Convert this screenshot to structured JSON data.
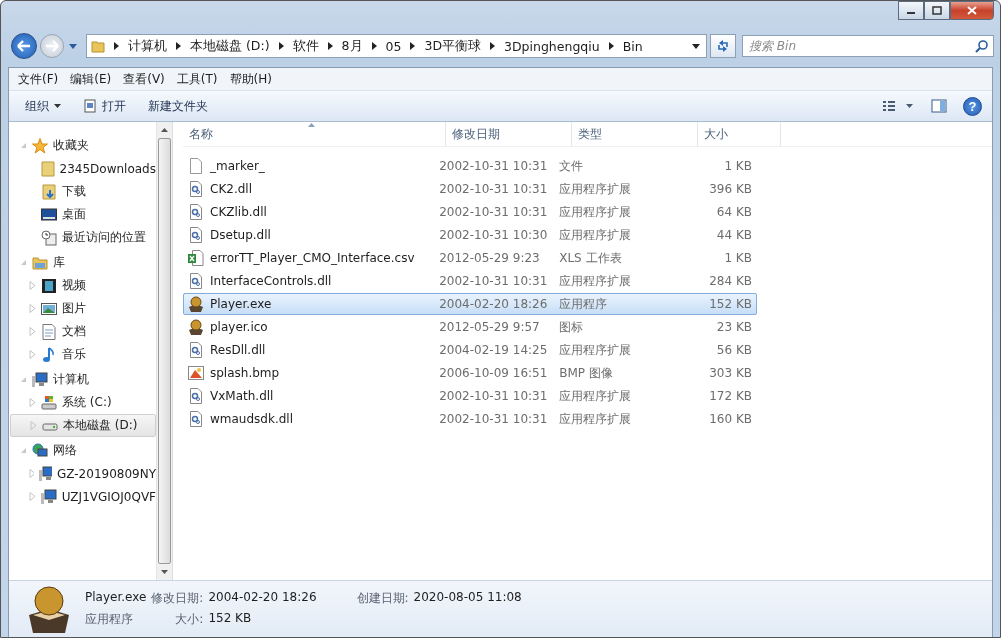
{
  "address_bar": {
    "path": [
      "计算机",
      "本地磁盘 (D:)",
      "软件",
      "8月",
      "05",
      "3D平衡球",
      "3Dpinghengqiu",
      "Bin"
    ]
  },
  "search": {
    "placeholder": "搜索 Bin"
  },
  "menu_bar": [
    "文件(F)",
    "编辑(E)",
    "查看(V)",
    "工具(T)",
    "帮助(H)"
  ],
  "toolbar": [
    {
      "label": "组织",
      "kind": "dropdown"
    },
    {
      "label": "打开",
      "kind": "open"
    },
    {
      "label": "新建文件夹",
      "kind": "plain"
    }
  ],
  "help_button": {
    "label": "?"
  },
  "sidebar": {
    "groups": [
      {
        "label": "收藏夹",
        "kind": "star",
        "expanded": true,
        "children": [
          {
            "label": "2345Downloads",
            "kind": "folder",
            "selected": false,
            "expandable": false
          },
          {
            "label": "下载",
            "kind": "download",
            "selected": false,
            "expandable": false
          },
          {
            "label": "桌面",
            "kind": "desktop",
            "selected": false,
            "expandable": false
          },
          {
            "label": "最近访问的位置",
            "kind": "recent",
            "selected": false,
            "expandable": false
          }
        ]
      },
      {
        "label": "库",
        "kind": "library",
        "expanded": true,
        "children": [
          {
            "label": "视频",
            "kind": "video",
            "selected": false,
            "expandable": true
          },
          {
            "label": "图片",
            "kind": "picture",
            "selected": false,
            "expandable": true
          },
          {
            "label": "文档",
            "kind": "document",
            "selected": false,
            "expandable": true
          },
          {
            "label": "音乐",
            "kind": "music",
            "selected": false,
            "expandable": true
          }
        ]
      },
      {
        "label": "计算机",
        "kind": "computer",
        "expanded": true,
        "children": [
          {
            "label": "系统 (C:)",
            "kind": "sysdrive",
            "selected": false,
            "expandable": true
          },
          {
            "label": "本地磁盘 (D:)",
            "kind": "drive",
            "selected": true,
            "expandable": true
          }
        ]
      },
      {
        "label": "网络",
        "kind": "network",
        "expanded": true,
        "children": [
          {
            "label": "GZ-20190809NY",
            "kind": "computer",
            "selected": false,
            "expandable": true
          },
          {
            "label": "UZJ1VGIOJ0QVF",
            "kind": "computer",
            "selected": false,
            "expandable": true
          }
        ]
      }
    ]
  },
  "table": {
    "columns": [
      {
        "label": "名称",
        "sorted": true
      },
      {
        "label": "修改日期",
        "sorted": false
      },
      {
        "label": "类型",
        "sorted": false
      },
      {
        "label": "大小",
        "sorted": false
      }
    ],
    "rows": [
      {
        "name": "_marker_",
        "date": "2002-10-31 10:31",
        "type": "文件",
        "size": "1 KB",
        "kind": "file",
        "selected": false
      },
      {
        "name": "CK2.dll",
        "date": "2002-10-31 10:31",
        "type": "应用程序扩展",
        "size": "396 KB",
        "kind": "dll",
        "selected": false
      },
      {
        "name": "CKZlib.dll",
        "date": "2002-10-31 10:31",
        "type": "应用程序扩展",
        "size": "64 KB",
        "kind": "dll",
        "selected": false
      },
      {
        "name": "Dsetup.dll",
        "date": "2002-10-31 10:30",
        "type": "应用程序扩展",
        "size": "44 KB",
        "kind": "dll",
        "selected": false
      },
      {
        "name": "errorTT_Player_CMO_Interface.csv",
        "date": "2012-05-29 9:23",
        "type": "XLS 工作表",
        "size": "1 KB",
        "kind": "csv",
        "selected": false
      },
      {
        "name": "InterfaceControls.dll",
        "date": "2002-10-31 10:31",
        "type": "应用程序扩展",
        "size": "284 KB",
        "kind": "dll",
        "selected": false
      },
      {
        "name": "Player.exe",
        "date": "2004-02-20 18:26",
        "type": "应用程序",
        "size": "152 KB",
        "kind": "exe",
        "selected": true
      },
      {
        "name": "player.ico",
        "date": "2012-05-29 9:57",
        "type": "图标",
        "size": "23 KB",
        "kind": "exe",
        "selected": false
      },
      {
        "name": "ResDll.dll",
        "date": "2004-02-19 14:25",
        "type": "应用程序扩展",
        "size": "56 KB",
        "kind": "dll",
        "selected": false
      },
      {
        "name": "splash.bmp",
        "date": "2006-10-09 16:51",
        "type": "BMP 图像",
        "size": "303 KB",
        "kind": "bmp",
        "selected": false
      },
      {
        "name": "VxMath.dll",
        "date": "2002-10-31 10:31",
        "type": "应用程序扩展",
        "size": "172 KB",
        "kind": "dll",
        "selected": false
      },
      {
        "name": "wmaudsdk.dll",
        "date": "2002-10-31 10:31",
        "type": "应用程序扩展",
        "size": "160 KB",
        "kind": "dll",
        "selected": false
      }
    ]
  },
  "details_pane": {
    "name": "Player.exe",
    "type": "应用程序",
    "fields": [
      {
        "label": "修改日期:",
        "value": "2004-02-20 18:26"
      },
      {
        "label": "创建日期:",
        "value": "2020-08-05 11:08"
      },
      {
        "label": "大小:",
        "value": "152 KB"
      }
    ]
  }
}
